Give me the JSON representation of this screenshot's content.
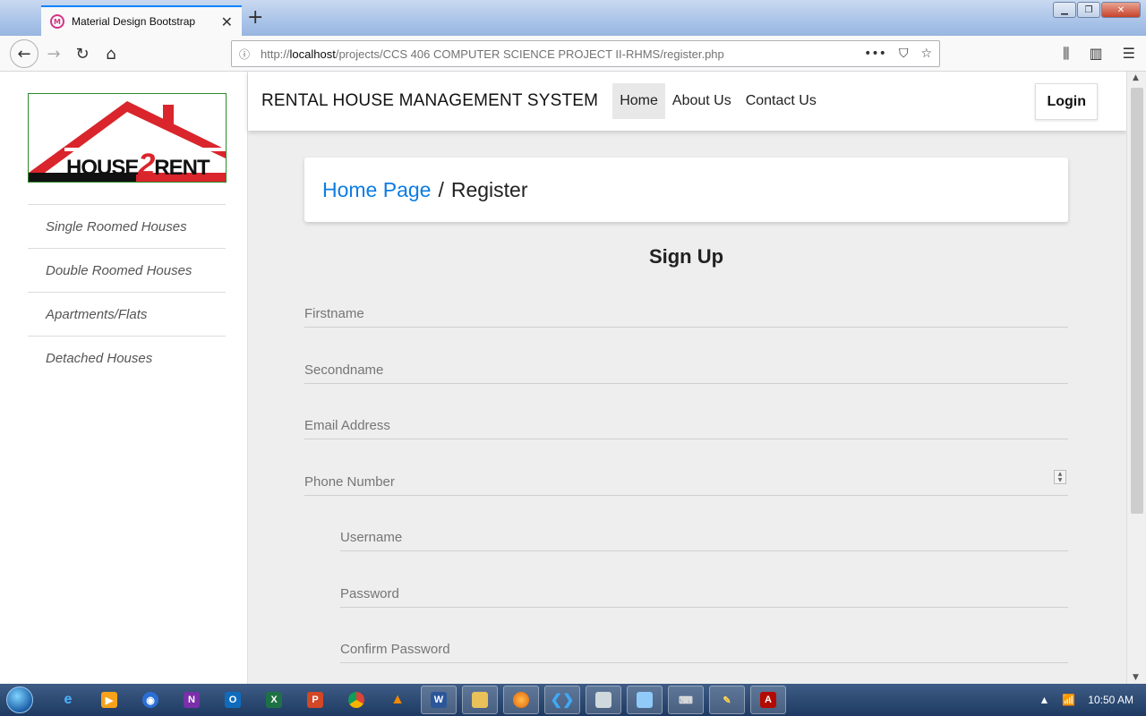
{
  "browser": {
    "tab_title": "Material Design Bootstrap",
    "url_prefix": "http://",
    "url_host": "localhost",
    "url_path": "/projects/CCS 406 COMPUTER SCIENCE PROJECT II-RHMS/register.php",
    "icons": [
      "back-icon",
      "forward-icon",
      "reload-icon",
      "home-icon",
      "info-icon",
      "more-icon",
      "pocket-icon",
      "star-icon",
      "library-icon",
      "sidebar-icon",
      "menu-icon"
    ]
  },
  "sidebar": {
    "logo_text_left": "HOUSE",
    "logo_text_mid": "2",
    "logo_text_right": "RENT",
    "items": [
      {
        "label": "Single Roomed Houses"
      },
      {
        "label": "Double Roomed Houses"
      },
      {
        "label": "Apartments/Flats"
      },
      {
        "label": "Detached Houses"
      }
    ]
  },
  "topnav": {
    "brand": "RENTAL HOUSE MANAGEMENT SYSTEM",
    "links": [
      {
        "label": "Home",
        "active": true
      },
      {
        "label": "About Us"
      },
      {
        "label": "Contact Us"
      }
    ],
    "login_label": "Login"
  },
  "breadcrumb": {
    "home_label": "Home Page",
    "separator": "/",
    "current": "Register"
  },
  "form": {
    "title": "Sign Up",
    "fields": [
      {
        "label": "Firstname"
      },
      {
        "label": "Secondname"
      },
      {
        "label": "Email Address"
      },
      {
        "label": "Phone Number"
      },
      {
        "label": "Username"
      },
      {
        "label": "Password"
      },
      {
        "label": "Confirm Password"
      }
    ]
  },
  "taskbar": {
    "apps": [
      "ie-icon",
      "media-icon",
      "firefox-dev-icon",
      "onenote-icon",
      "outlook-icon",
      "excel-icon",
      "powerpoint-icon",
      "chrome-icon",
      "vlc-icon",
      "word-icon",
      "explorer-icon",
      "firefox-icon",
      "vscode-icon",
      "window-icon",
      "rdp-icon",
      "keyboard-icon",
      "paint-icon",
      "acrobat-icon"
    ],
    "clock": "10:50 AM"
  },
  "colors": {
    "link_blue": "#0d7ce3",
    "logo_red": "#d9252b",
    "page_bg": "#eeeeee"
  }
}
